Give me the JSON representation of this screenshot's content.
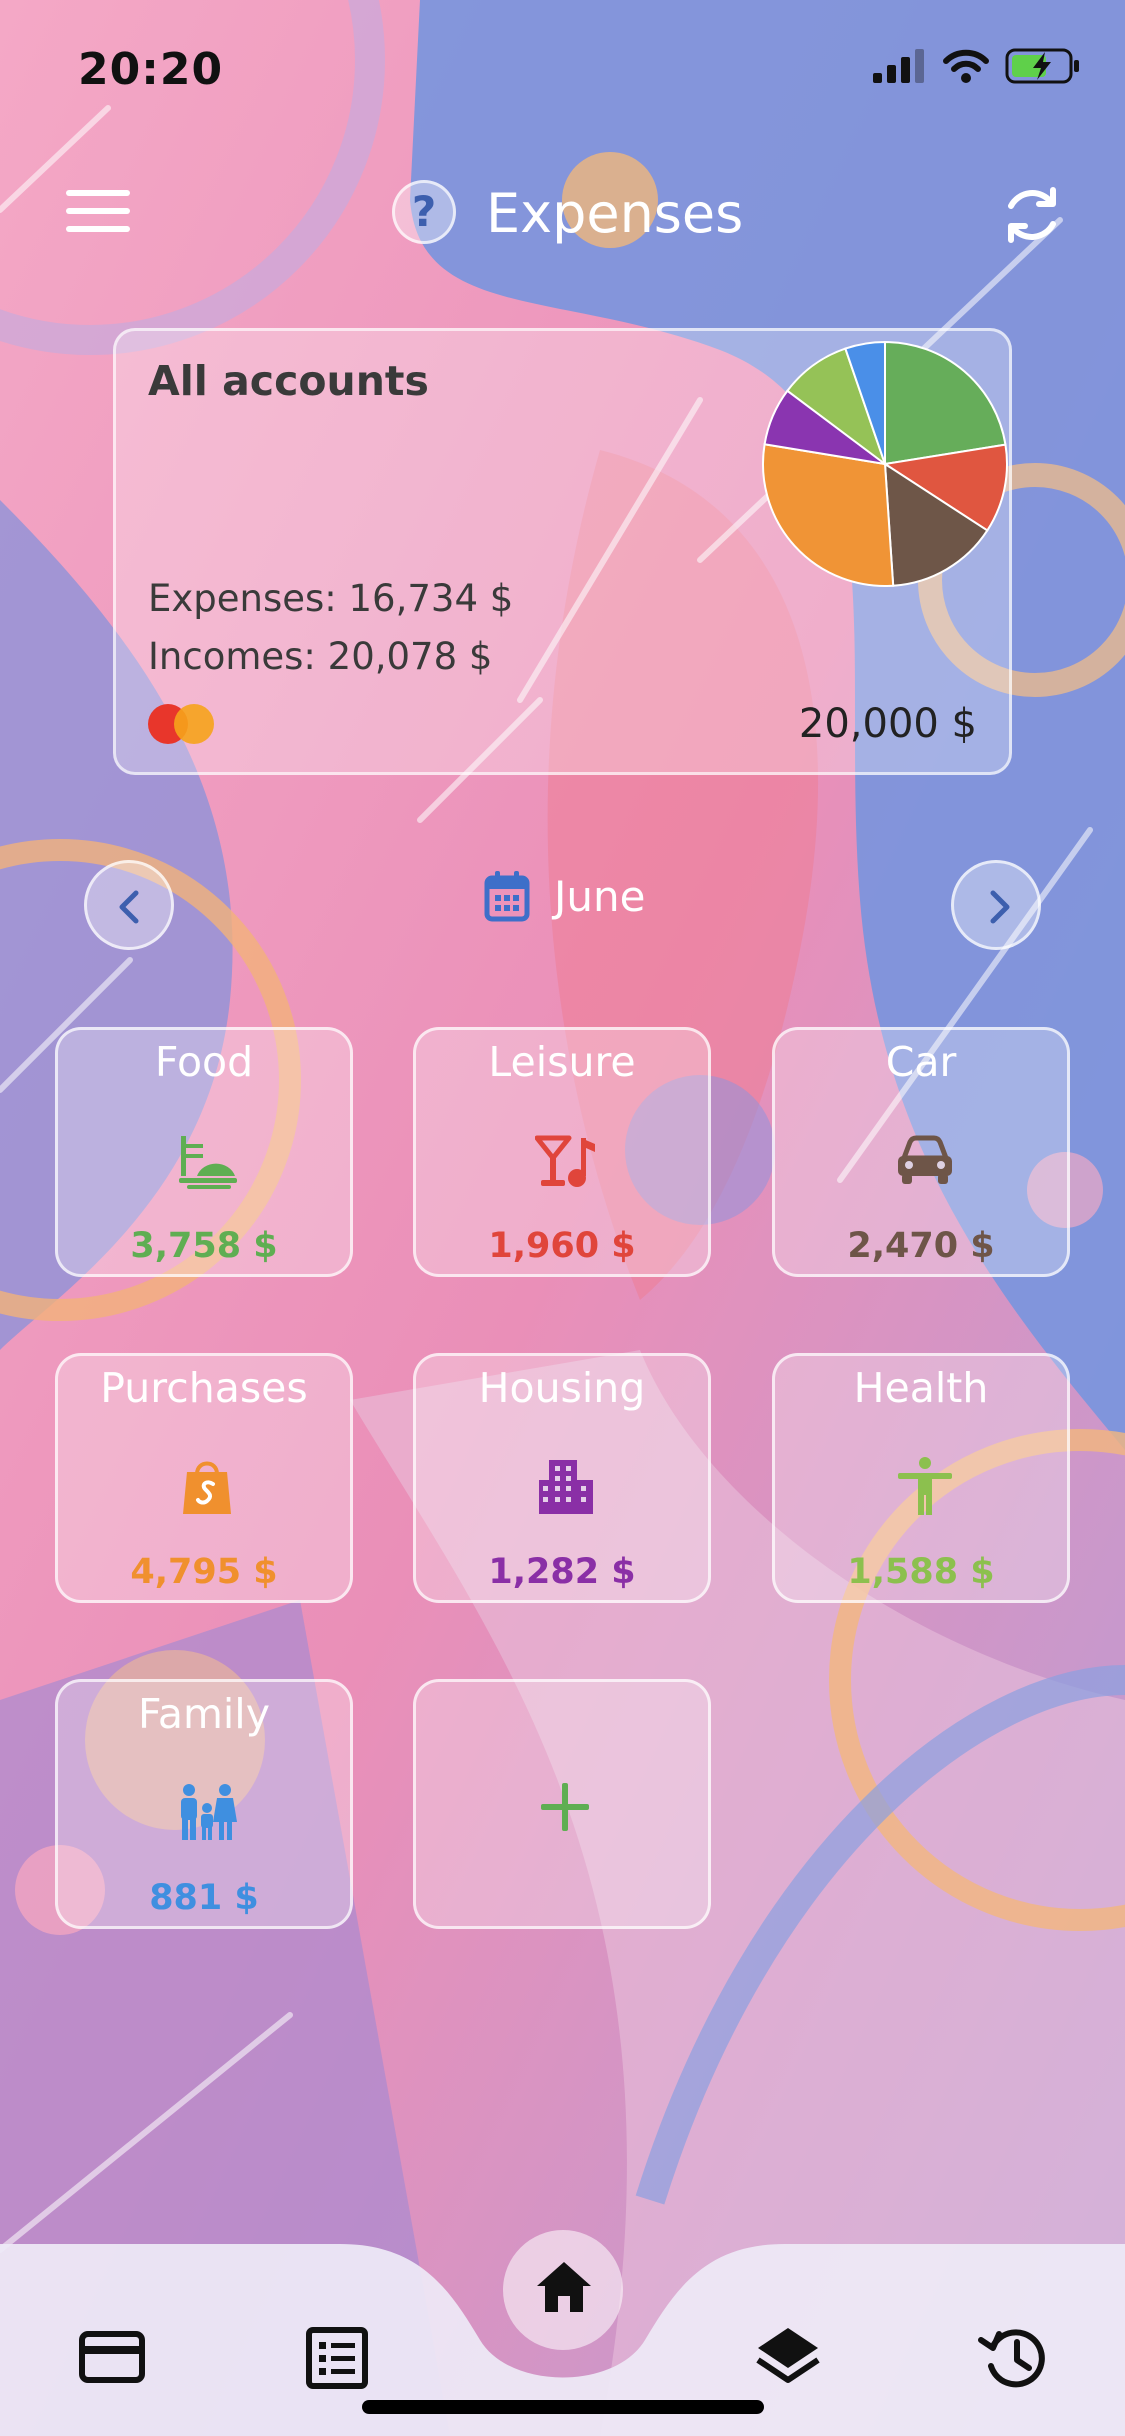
{
  "status_bar": {
    "time": "20:20"
  },
  "header": {
    "title": "Expenses",
    "help_symbol": "?",
    "menu_icon": "hamburger-menu-icon",
    "refresh_icon": "refresh-icon"
  },
  "account": {
    "name": "All accounts",
    "expenses": "Expenses: 16,734 $",
    "incomes": "Incomes: 20,078 $",
    "balance": "20,000 $",
    "card_brand_icon": "mastercard-logo"
  },
  "month_selector": {
    "label": "June",
    "icon": "calendar-icon"
  },
  "categories": [
    {
      "name": "Food",
      "amount": "3,758 $",
      "icon": "food-icon",
      "color": "#5fae52"
    },
    {
      "name": "Leisure",
      "amount": "1,960 $",
      "icon": "cocktail-music-icon",
      "color": "#e0453b"
    },
    {
      "name": "Car",
      "amount": "2,470 $",
      "icon": "car-icon",
      "color": "#6e5548"
    },
    {
      "name": "Purchases",
      "amount": "4,795 $",
      "icon": "shopping-bag-icon",
      "color": "#f0902e"
    },
    {
      "name": "Housing",
      "amount": "1,282 $",
      "icon": "building-icon",
      "color": "#8a2fa6"
    },
    {
      "name": "Health",
      "amount": "1,588 $",
      "icon": "accessibility-person-icon",
      "color": "#8cc04e"
    },
    {
      "name": "Family",
      "amount": "881 $",
      "icon": "family-icon",
      "color": "#3f8fe0"
    }
  ],
  "add_category": {
    "symbol": "+",
    "color": "#5fae52"
  },
  "pie_chart_data": {
    "type": "pie",
    "slices": [
      {
        "label": "Food",
        "value": 3758,
        "color": "#66ad5a"
      },
      {
        "label": "Leisure",
        "value": 1960,
        "color": "#e05640"
      },
      {
        "label": "Car",
        "value": 2470,
        "color": "#6e5648"
      },
      {
        "label": "Purchases",
        "value": 4795,
        "color": "#f09436"
      },
      {
        "label": "Housing",
        "value": 1282,
        "color": "#8a35b0"
      },
      {
        "label": "Health",
        "value": 1588,
        "color": "#95c257"
      },
      {
        "label": "Family",
        "value": 881,
        "color": "#4a8fe8"
      }
    ]
  },
  "bottom_nav": {
    "items": [
      "card-icon",
      "list-icon",
      "home-icon",
      "layers-icon",
      "history-icon"
    ],
    "active": "home-icon"
  }
}
